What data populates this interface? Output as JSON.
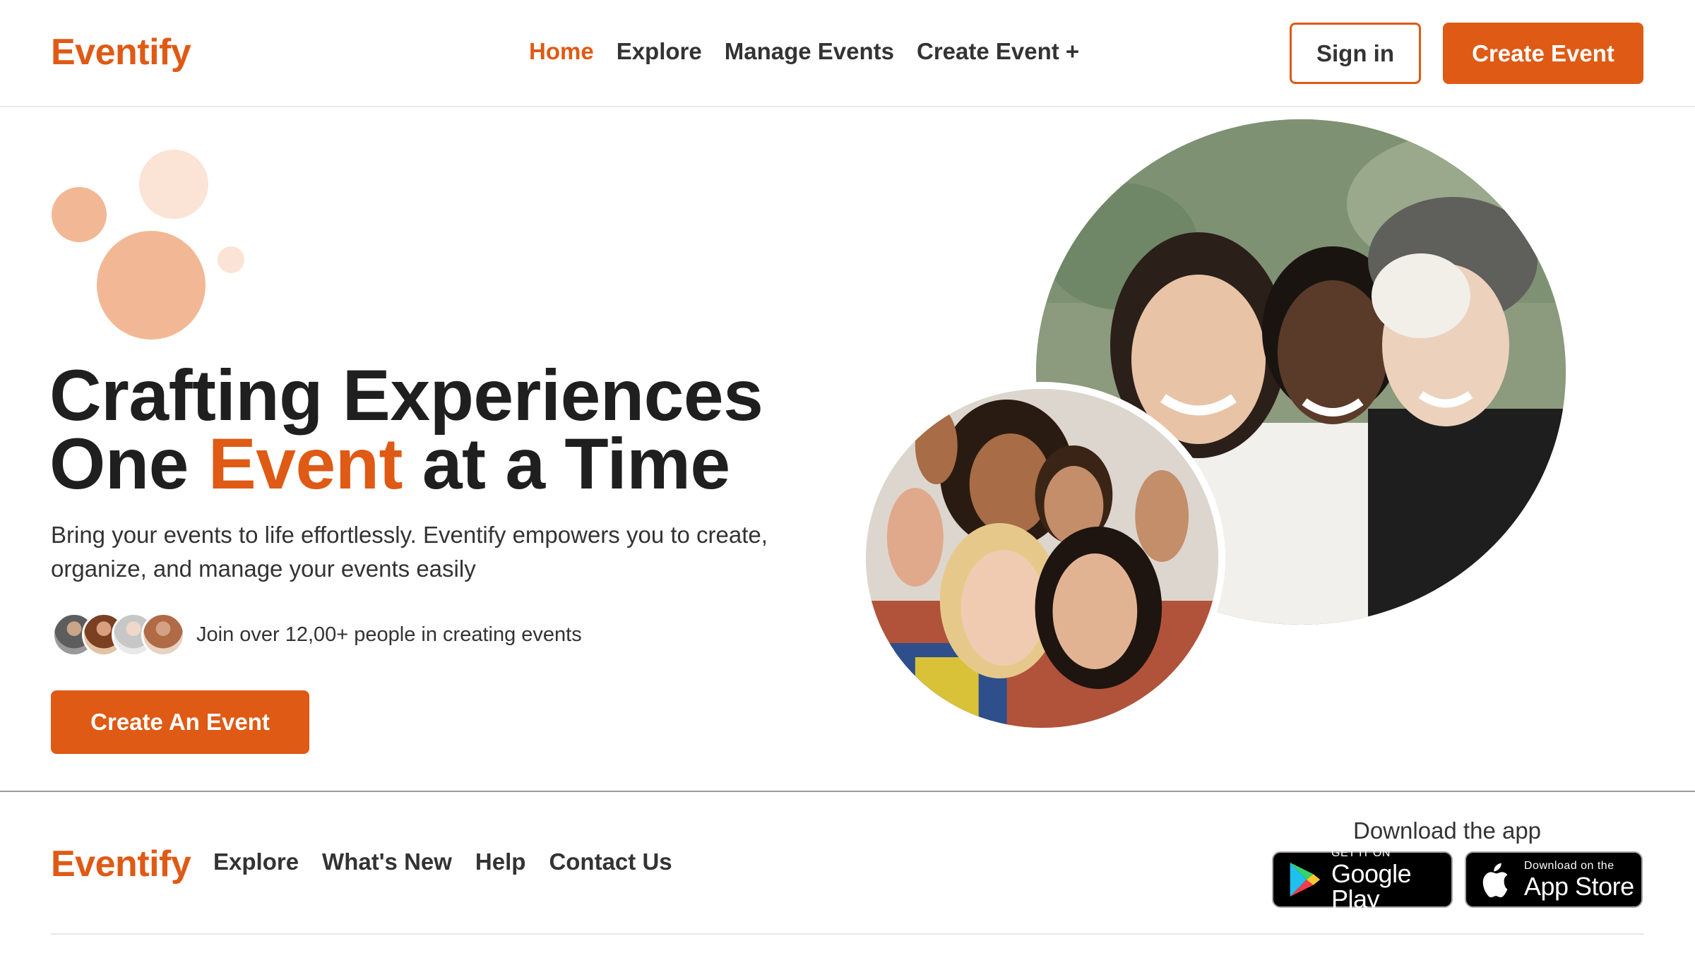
{
  "brand": {
    "name": "Eventify",
    "accent_color": "#df5a15"
  },
  "header": {
    "nav": [
      {
        "label": "Home",
        "active": true
      },
      {
        "label": "Explore",
        "active": false
      },
      {
        "label": "Manage Events",
        "active": false
      },
      {
        "label": "Create Event +",
        "active": false
      }
    ],
    "sign_in_label": "Sign in",
    "create_event_label": "Create Event"
  },
  "hero": {
    "title_line1": "Crafting Experiences",
    "title_line2_before": "One ",
    "title_line2_accent": "Event",
    "title_line2_after": " at a Time",
    "subtitle": "Bring your events to life effortlessly. Eventify empowers you to create, organize, and manage your events easily",
    "social_proof": "Join over 12,00+ people in creating events",
    "cta_label": "Create An Event"
  },
  "footer": {
    "nav": [
      "Explore",
      "What's New",
      "Help",
      "Contact Us"
    ],
    "download_label": "Download the app",
    "google_play": {
      "small": "GET IT ON",
      "big": "Google Play",
      "icon": "google-play-icon"
    },
    "app_store": {
      "small": "Download on the",
      "big": "App Store",
      "icon": "apple-icon"
    }
  }
}
